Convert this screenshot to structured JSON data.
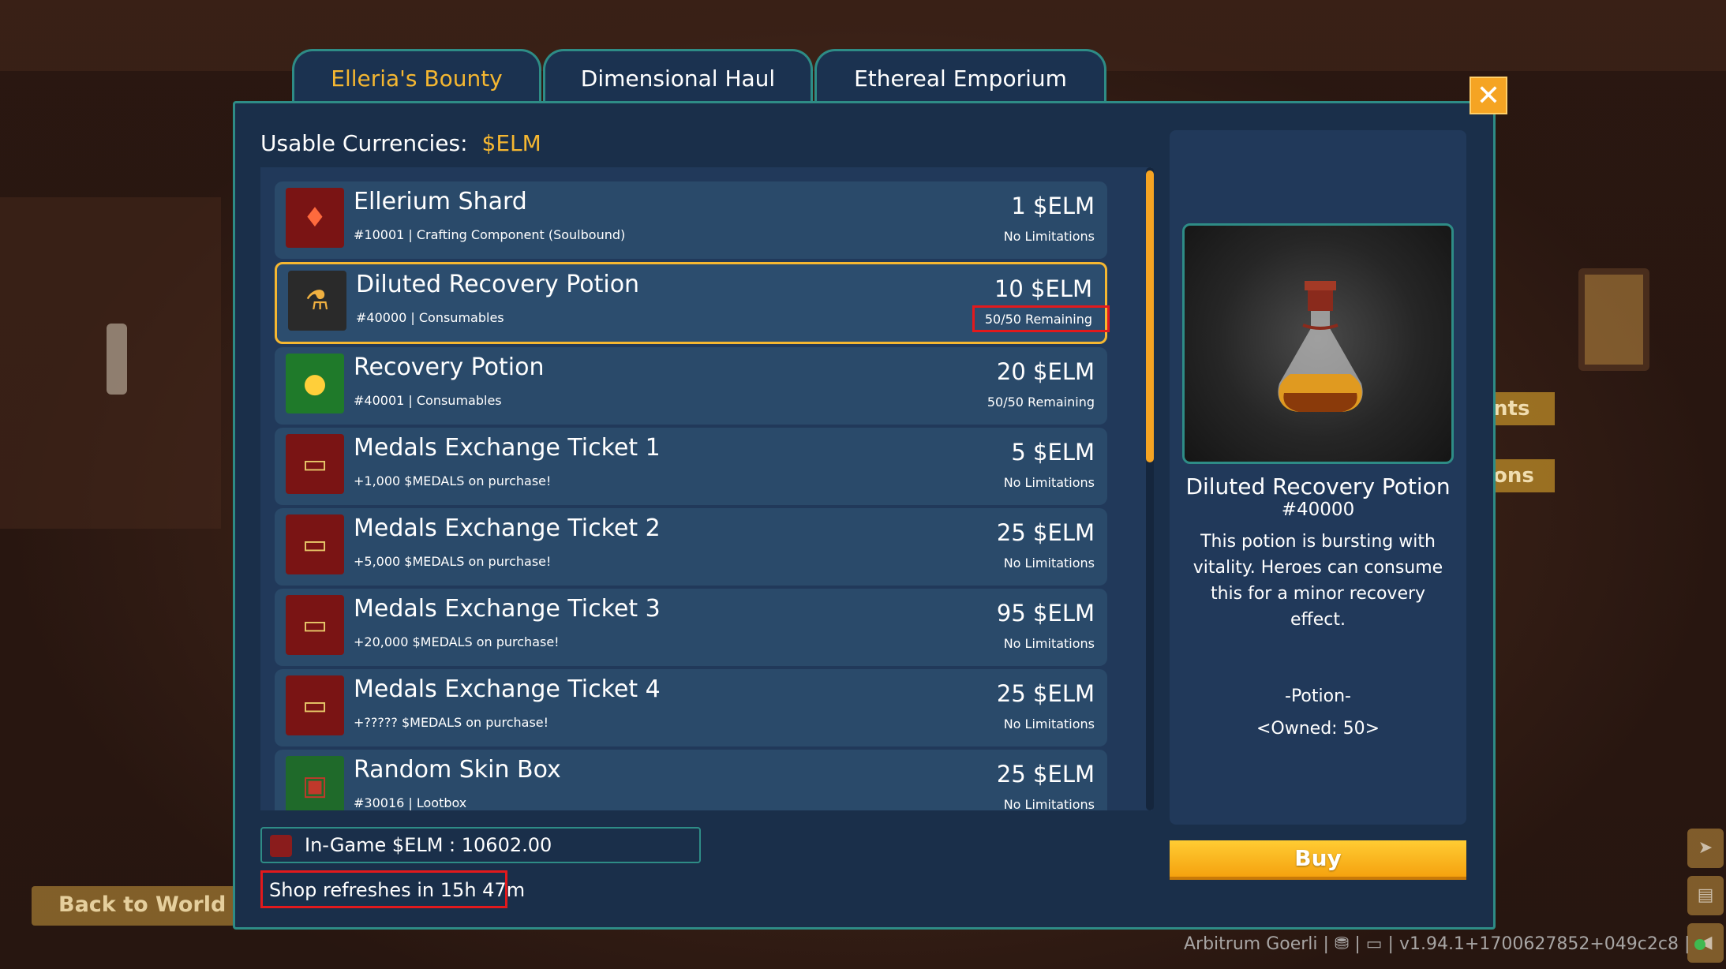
{
  "tabs": [
    {
      "label": "Elleria's Bounty",
      "active": true
    },
    {
      "label": "Dimensional Haul",
      "active": false
    },
    {
      "label": "Ethereal Emporium",
      "active": false
    }
  ],
  "close_label": "✕",
  "currencies": {
    "label": "Usable Currencies:",
    "value": "$ELM"
  },
  "items": [
    {
      "name": "Ellerium Shard",
      "desc": "#10001 | Crafting Component (Soulbound)",
      "price": "1 $ELM",
      "limit": "No Limitations",
      "icon": "red-crystal-icon"
    },
    {
      "name": "Diluted Recovery Potion",
      "desc": "#40000 | Consumables",
      "price": "10 $ELM",
      "limit": "50/50 Remaining",
      "icon": "potion-flask-icon"
    },
    {
      "name": "Recovery Potion",
      "desc": "#40001 | Consumables",
      "price": "20 $ELM",
      "limit": "50/50 Remaining",
      "icon": "green-potion-icon"
    },
    {
      "name": "Medals Exchange Ticket 1",
      "desc": "+1,000 $MEDALS on purchase!",
      "price": "5 $ELM",
      "limit": "No Limitations",
      "icon": "ticket-icon"
    },
    {
      "name": "Medals Exchange Ticket 2",
      "desc": "+5,000 $MEDALS on purchase!",
      "price": "25 $ELM",
      "limit": "No Limitations",
      "icon": "ticket-icon"
    },
    {
      "name": "Medals Exchange Ticket 3",
      "desc": "+20,000 $MEDALS on purchase!",
      "price": "95 $ELM",
      "limit": "No Limitations",
      "icon": "ticket-icon"
    },
    {
      "name": "Medals Exchange Ticket 4",
      "desc": "+????? $MEDALS on purchase!",
      "price": "25 $ELM",
      "limit": "No Limitations",
      "icon": "ticket-icon"
    },
    {
      "name": "Random Skin Box",
      "desc": "#30016 | Lootbox",
      "price": "25 $ELM",
      "limit": "No Limitations",
      "icon": "treasure-chest-icon"
    }
  ],
  "detail": {
    "title": "Diluted Recovery Potion",
    "id": "#40000",
    "body": "This potion is bursting with vitality. Heroes can consume this for a minor recovery effect.",
    "category": "-Potion-",
    "owned": "<Owned: 50>"
  },
  "buy_label": "Buy",
  "balance": "In-Game $ELM : 10602.00",
  "refresh": "Shop refreshes in 15h 47m",
  "back_label": "Back to World M",
  "footer": "Arbitrum Goerli | ⛃ | ▭ | v1.94.1+1700627852+049c2c8 |",
  "colors": {
    "accent": "#f5b731",
    "teal": "#2e8c86",
    "panel": "#1a2f4a",
    "highlight": "#e3191c"
  },
  "bg_signs": [
    "nts",
    "ons"
  ]
}
